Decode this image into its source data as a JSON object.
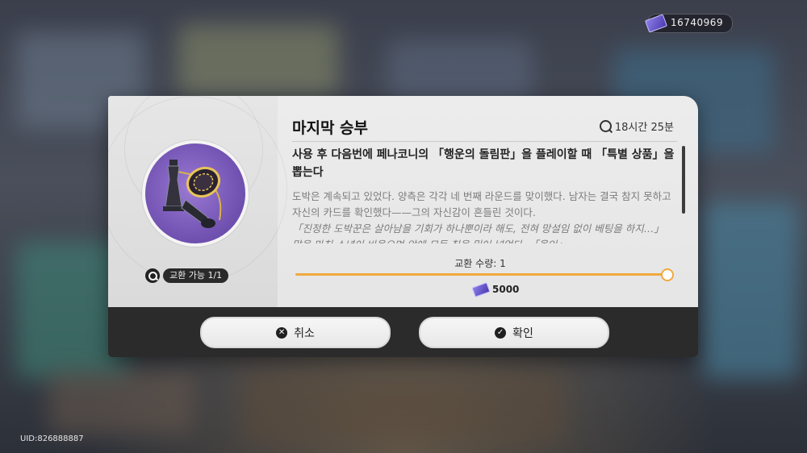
{
  "header": {
    "currency_amount": "16740969",
    "currency_icon": "pass-ticket-icon"
  },
  "item": {
    "title": "마지막 승부",
    "timer": "18시간 25분",
    "effect": "사용 후 다음번에 페나코니의 「행운의 돌림판」을 플레이할 때 「특별 상품」을 뽑는다",
    "desc_lines": [
      "도박은 계속되고 있었다. 양측은 각각 네 번째 라운드를 맞이했다. 남자는 결국 참지 못하고 자신의 카드를 확인했다——그의 자신감이 흔들린 것이다.",
      "「진정한 도박꾼은 살아남을 기회가 하나뿐이라 해도, 전혀 망설임 없이 베팅을 하지…」 말을 마친 소년이 비웃으며 앞에 모든 칩을 밀어 넣었다. 「올인」"
    ],
    "exchange_label": "교환 가능 1/1"
  },
  "exchange": {
    "qty_label": "교환 수량: 1",
    "cost": "5000",
    "fill_fraction": 1.0,
    "accent": "#f0a93e"
  },
  "buttons": {
    "cancel": "취소",
    "confirm": "확인"
  },
  "footer": {
    "uid": "UID:826888887"
  }
}
